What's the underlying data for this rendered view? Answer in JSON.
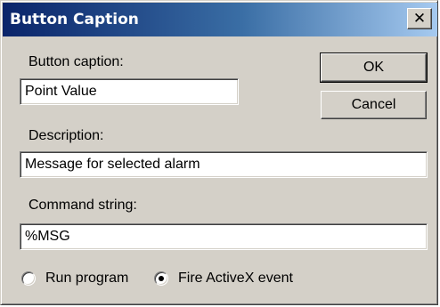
{
  "window": {
    "title": "Button Caption",
    "close_icon": "close-icon"
  },
  "button_caption": {
    "label": "Button caption:",
    "value": "Point Value"
  },
  "description": {
    "label": "Description:",
    "value": "Message for selected alarm"
  },
  "command_string": {
    "label": "Command string:",
    "value": "%MSG"
  },
  "buttons": {
    "ok_label": "OK",
    "cancel_label": "Cancel"
  },
  "options": {
    "run_program_label": "Run program",
    "fire_activex_label": "Fire ActiveX event",
    "selected": "Fire ActiveX event"
  }
}
